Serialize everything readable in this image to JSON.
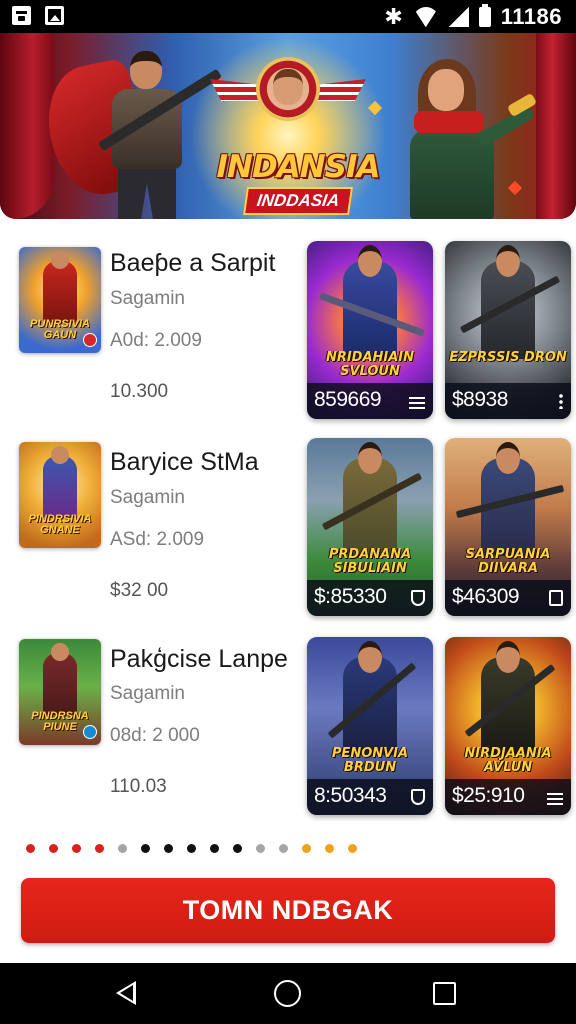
{
  "status_bar": {
    "time": "11186",
    "icons": [
      "notification-icon",
      "gallery-icon",
      "settings-icon",
      "wifi-icon",
      "signal-icon",
      "battery-icon"
    ]
  },
  "banner": {
    "title": "INDANSIA",
    "subtitle": "INDDASIA"
  },
  "rows": [
    {
      "title": "Baeƥe a Sarpit",
      "subtitle": "Sagamin",
      "date": "A0d: 2.009",
      "price": "10.300",
      "thumb_caption": "PUNRSIVIA GAUN",
      "cards": [
        {
          "title": "NRIDAHIAIN SVLOUN",
          "price": "859669",
          "icon": "menu-icon"
        },
        {
          "title": "EZPRSSIS DRON",
          "price": "$8938",
          "icon": "more-vert-icon"
        }
      ]
    },
    {
      "title": "Baryice StMa",
      "subtitle": "Sagamin",
      "date": "ASd: 2.009",
      "price": "$32 00",
      "thumb_caption": "PINDRSIVIA GNANE",
      "cards": [
        {
          "title": "PRDANANA SIBULIAIN",
          "price": "$:85330",
          "icon": "shield-icon"
        },
        {
          "title": "SARPUANIA DIIVARA",
          "price": "$46309",
          "icon": "cart-icon"
        }
      ]
    },
    {
      "title": "Pakģcise Lanpe",
      "subtitle": "Sagamin",
      "date": "08d: 2 000",
      "price": "110.03",
      "thumb_caption": "PINDRSNA PIUNE",
      "cards": [
        {
          "title": "PENONVIA BRDUN",
          "price": "8:50343",
          "icon": "shield-icon"
        },
        {
          "title": "NIRDJAANIA AVLUN",
          "price": "$25:910",
          "icon": "menu-icon"
        }
      ]
    }
  ],
  "pagination": {
    "dots": [
      "#d8231c",
      "#d8231c",
      "#d8231c",
      "#d8231c",
      "#a5a5a5",
      "#111111",
      "#111111",
      "#111111",
      "#111111",
      "#111111",
      "#a5a5a5",
      "#a5a5a5",
      "#f0a21c",
      "#f0a21c",
      "#f0a21c"
    ]
  },
  "cta": {
    "label": "TOMN NDBGAK"
  },
  "colors": {
    "accent": "#d8231c",
    "text_secondary": "#7d7d7d"
  },
  "nav": {
    "icons": [
      "back-icon",
      "home-icon",
      "recents-icon"
    ]
  }
}
